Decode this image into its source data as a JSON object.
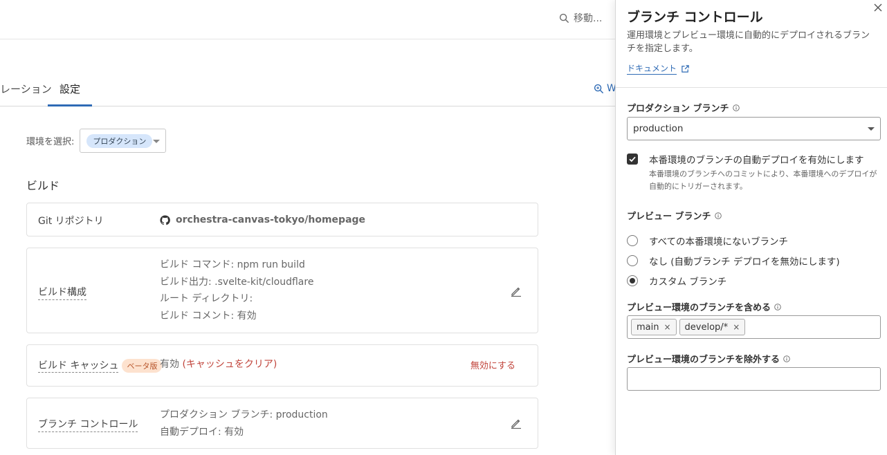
{
  "header": {
    "search_placeholder": "移動..."
  },
  "tabs": [
    {
      "label": "レーション"
    },
    {
      "label": "設定"
    }
  ],
  "peek_link": "W",
  "env_select": {
    "label": "環境を選択:",
    "value": "プロダクション"
  },
  "build": {
    "section_title": "ビルド",
    "git": {
      "label": "Git リポジトリ",
      "repo": "orchestra-canvas-tokyo/homepage"
    },
    "config": {
      "label": "ビルド構成",
      "lines": [
        "ビルド コマンド: npm run build",
        "ビルド出力: .svelte-kit/cloudflare",
        "ルート ディレクトリ:",
        "ビルド コメント: 有効"
      ]
    },
    "cache": {
      "label": "ビルド キャッシュ",
      "badge": "ベータ版",
      "status": "有効",
      "clear_link": "キャッシュをクリア",
      "disable_link": "無効にする"
    },
    "branch": {
      "label": "ブランチ コントロール",
      "lines": [
        "プロダクション ブランチ: production",
        "自動デプロイ: 有効"
      ]
    }
  },
  "panel": {
    "title": "ブランチ コントロール",
    "description": "運用環境とプレビュー環境に自動的にデプロイされるブランチを指定します。",
    "doc_link": "ドキュメント",
    "production": {
      "label": "プロダクション ブランチ",
      "value": "production"
    },
    "auto_deploy": {
      "checked": true,
      "label": "本番環境のブランチの自動デプロイを有効にします",
      "help": "本番環境のブランチへのコミットにより、本番環境へのデプロイが自動的にトリガーされます。"
    },
    "preview": {
      "label": "プレビュー ブランチ",
      "options": [
        {
          "label": "すべての本番環境にないブランチ",
          "selected": false
        },
        {
          "label": "なし (自動ブランチ デプロイを無効にします)",
          "selected": false
        },
        {
          "label": "カスタム ブランチ",
          "selected": true
        }
      ]
    },
    "include": {
      "label": "プレビュー環境のブランチを含める",
      "tags": [
        "main",
        "develop/*"
      ],
      "remove_glyph": "×"
    },
    "exclude": {
      "label": "プレビュー環境のブランチを除外する",
      "value": ""
    }
  },
  "colors": {
    "accent": "#2f6bb5",
    "danger": "#c1443b",
    "beta_bg": "#fde2cf",
    "env_pill_bg": "#d6e6fb"
  }
}
